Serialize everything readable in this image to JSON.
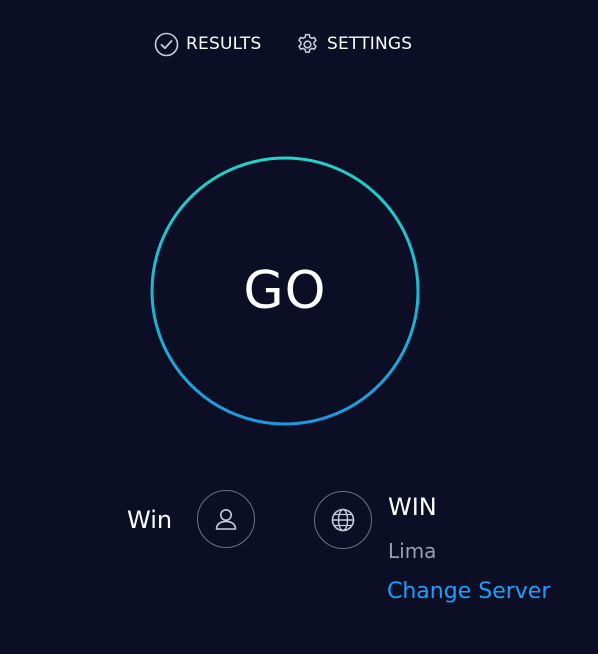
{
  "nav": {
    "results_label": "RESULTS",
    "results_icon": "check-circle-icon",
    "settings_label": "SETTINGS",
    "settings_icon": "gear-icon"
  },
  "go_button": {
    "label": "GO",
    "ring_colors": [
      "#1fd4c8",
      "#1a9be0"
    ]
  },
  "provider": {
    "name": "Win",
    "icon": "user-icon"
  },
  "server": {
    "icon": "globe-icon",
    "name": "WIN",
    "location": "Lima",
    "change_label": "Change Server"
  },
  "colors": {
    "background": "#0b0e24",
    "accent": "#1aa0ff",
    "muted_text": "#9a9db3"
  }
}
